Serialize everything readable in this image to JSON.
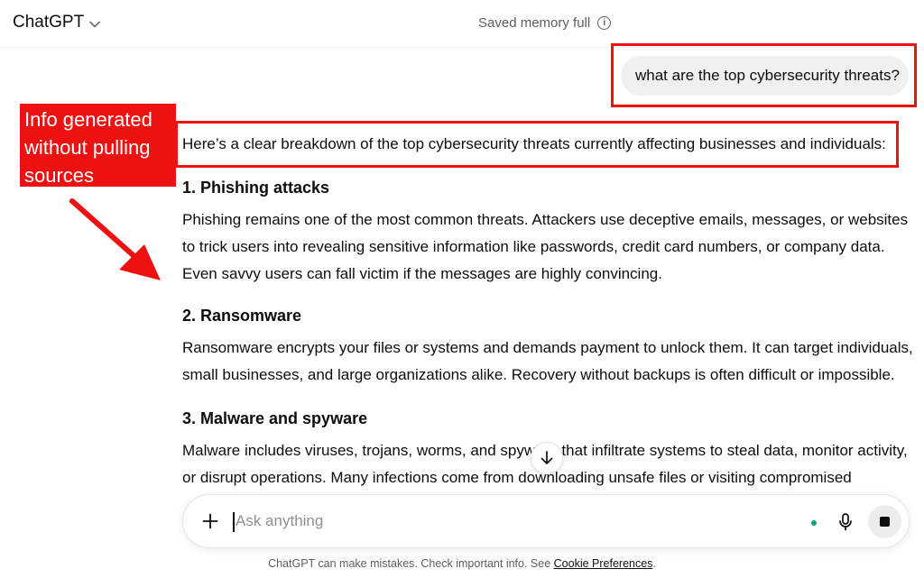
{
  "header": {
    "app_title": "ChatGPT",
    "memory_status": "Saved memory full"
  },
  "conversation": {
    "user_message": "what are the top cybersecurity threats?",
    "response": {
      "intro": "Here’s a clear breakdown of the top cybersecurity threats currently affecting businesses and individuals:",
      "sections": [
        {
          "heading": "1. Phishing attacks",
          "body": "Phishing remains one of the most common threats. Attackers use deceptive emails, messages, or websites to trick users into revealing sensitive information like passwords, credit card numbers, or company data. Even savvy users can fall victim if the messages are highly convincing."
        },
        {
          "heading": "2. Ransomware",
          "body": "Ransomware encrypts your files or systems and demands payment to unlock them. It can target individuals, small businesses, and large organizations alike. Recovery without backups is often difficult or impossible."
        },
        {
          "heading": "3. Malware and spyware",
          "body": "Malware includes viruses, trojans, worms, and spyware that infiltrate systems to steal data, monitor activity, or disrupt operations. Many infections come from downloading unsafe files or visiting compromised websites."
        }
      ]
    }
  },
  "annotation": {
    "label": "Info generated without pulling sources",
    "color": "#ee1111"
  },
  "composer": {
    "placeholder": "Ask anything"
  },
  "footer": {
    "disclaimer": "ChatGPT can make mistakes. Check important info. See",
    "link": "Cookie Preferences",
    "end": "."
  },
  "icons": [
    "chevron-down-icon",
    "info-icon",
    "arrow-down-icon",
    "plus-icon",
    "mic-icon",
    "stop-icon"
  ]
}
